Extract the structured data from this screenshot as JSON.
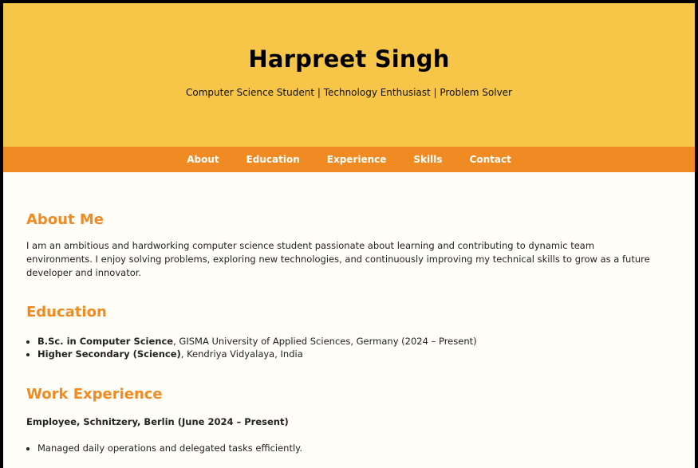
{
  "header": {
    "name": "Harpreet Singh",
    "tagline": "Computer Science Student | Technology Enthusiast | Problem Solver"
  },
  "nav": {
    "items": [
      "About",
      "Education",
      "Experience",
      "Skills",
      "Contact"
    ]
  },
  "about": {
    "title": "About Me",
    "text": "I am an ambitious and hardworking computer science student passionate about learning and contributing to dynamic team environments. I enjoy solving problems, exploring new technologies, and continuously improving my technical skills to grow as a future developer and innovator."
  },
  "education": {
    "title": "Education",
    "items": [
      {
        "degree": "B.Sc. in Computer Science",
        "detail": ", GISMA University of Applied Sciences, Germany (2024 – Present)"
      },
      {
        "degree": "Higher Secondary (Science)",
        "detail": ", Kendriya Vidyalaya, India"
      }
    ]
  },
  "experience": {
    "title": "Work Experience",
    "job": "Employee, Schnitzery, Berlin (June 2024 – Present)",
    "tasks": [
      "Managed daily operations and delegated tasks efficiently."
    ]
  },
  "colors": {
    "hero_bg": "#f7c548",
    "nav_bg": "#ef8b22",
    "accent": "#ef8b22",
    "page_bg": "#fffdf7"
  }
}
